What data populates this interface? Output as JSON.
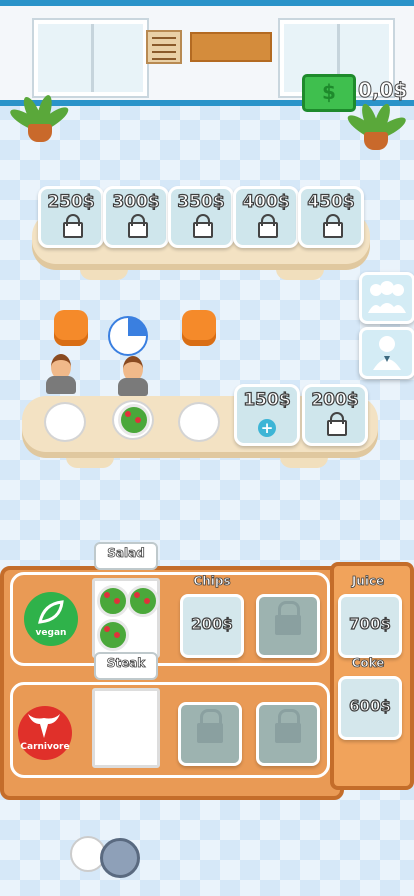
{
  "hud": {
    "money": "0,0$"
  },
  "top_counter": {
    "slots": [
      {
        "price": "250$"
      },
      {
        "price": "300$"
      },
      {
        "price": "350$"
      },
      {
        "price": "400$"
      },
      {
        "price": "450$"
      }
    ]
  },
  "dining_counter": {
    "slots": [
      {
        "price": "150$",
        "icon": "plus-icon"
      },
      {
        "price": "200$",
        "icon": "lock-icon"
      }
    ]
  },
  "side_buttons": [
    {
      "icon": "staff-group-icon"
    },
    {
      "icon": "manager-icon"
    }
  ],
  "kitchen": {
    "vegan": {
      "label": "vegan",
      "color": "#2fb24a"
    },
    "carnivore": {
      "label": "Carnivore",
      "color": "#e0302a"
    },
    "salad_sign": "Salad",
    "steak_sign": "Steak",
    "chips_label": "Chips",
    "chips_price": "200$",
    "juice_label": "Juice",
    "juice_price": "700$",
    "coke_label": "Coke",
    "coke_price": "600$"
  }
}
